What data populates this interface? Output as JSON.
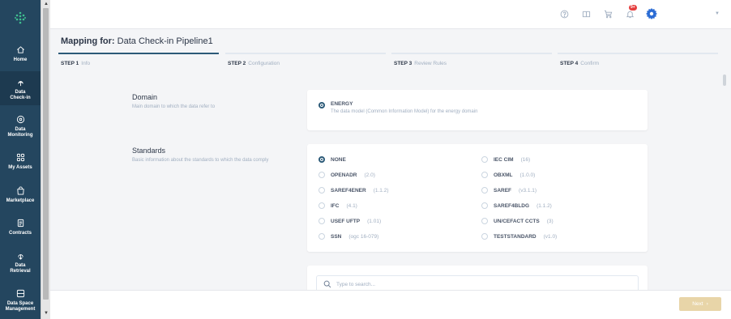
{
  "sidebar": {
    "items": [
      {
        "label": "Home",
        "icon": "home-icon"
      },
      {
        "label": "Data\nCheck-in",
        "icon": "upload-icon"
      },
      {
        "label": "Data\nMonitoring",
        "icon": "monitor-icon"
      },
      {
        "label": "My Assets",
        "icon": "grid-icon"
      },
      {
        "label": "Marketplace",
        "icon": "bag-icon"
      },
      {
        "label": "Contracts",
        "icon": "document-icon"
      },
      {
        "label": "Data\nRetrieval",
        "icon": "download-icon"
      },
      {
        "label": "Data Space\nManagement",
        "icon": "server-icon"
      }
    ]
  },
  "topbar": {
    "notifications_badge": "9+"
  },
  "header": {
    "title_prefix": "Mapping for:",
    "pipeline_name": "Data Check-in Pipeline1"
  },
  "steps": [
    {
      "number": "STEP 1",
      "name": "Info"
    },
    {
      "number": "STEP 2",
      "name": "Configuration"
    },
    {
      "number": "STEP 3",
      "name": "Review Rules"
    },
    {
      "number": "STEP 4",
      "name": "Confirm"
    }
  ],
  "domain": {
    "title": "Domain",
    "description": "Main domain to which the data refer to",
    "option_name": "ENERGY",
    "option_desc": "The data model (Common Information Model) for the energy domain"
  },
  "standards": {
    "title": "Standards",
    "description": "Basic information about the standards to which the data comply",
    "left": [
      {
        "name": "NONE",
        "version": ""
      },
      {
        "name": "OPENADR",
        "version": "(2.0)"
      },
      {
        "name": "SAREF4ENER",
        "version": "(1.1.2)"
      },
      {
        "name": "IFC",
        "version": "(4.1)"
      },
      {
        "name": "USEF UFTP",
        "version": "(1.01)"
      },
      {
        "name": "SSN",
        "version": "(ogc 16-079)"
      }
    ],
    "right": [
      {
        "name": "IEC CIM",
        "version": "(16)"
      },
      {
        "name": "OBXML",
        "version": "(1.0.0)"
      },
      {
        "name": "SAREF",
        "version": "(v3.1.1)"
      },
      {
        "name": "SAREF4BLDG",
        "version": "(1.1.2)"
      },
      {
        "name": "UN/CEFACT CCTS",
        "version": "(3)"
      },
      {
        "name": "TESTSTANDARD",
        "version": "(v1.0)"
      }
    ]
  },
  "search": {
    "placeholder": "Type to search..."
  },
  "footer": {
    "next_label": "Next",
    "next_color": "#e8d5a8"
  },
  "colors": {
    "sidebar": "#24465f",
    "accent": "#2c5a78"
  }
}
